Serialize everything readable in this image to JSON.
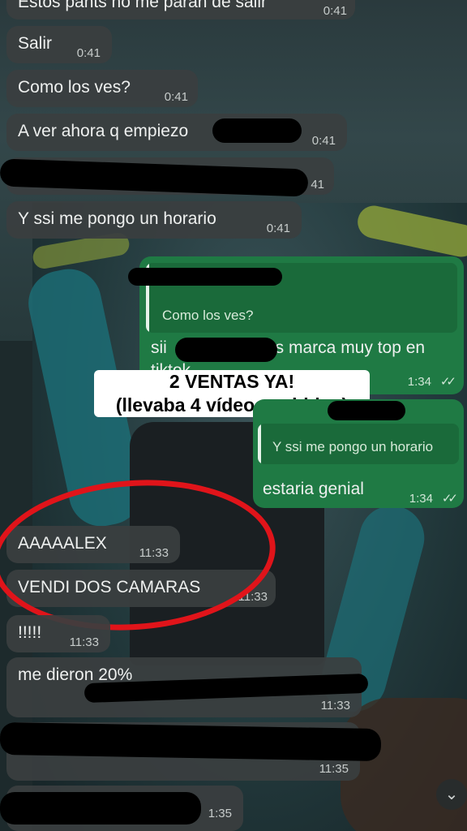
{
  "messages": [
    {
      "text": "Estos pants no me paran de salir",
      "time": "0:41"
    },
    {
      "text": "Salir",
      "time": "0:41"
    },
    {
      "text": "Como los ves?",
      "time": "0:41"
    },
    {
      "text": "A ver ahora q empiezo",
      "time": "0:41"
    },
    {
      "text": "",
      "time": "41"
    },
    {
      "text": "Y ssi me pongo un horario",
      "time": "0:41"
    },
    {
      "quote": "Como los ves?",
      "text": "sii",
      "text2": "es marca muy top en",
      "text3": "tiktok",
      "time": "1:34"
    },
    {
      "quote": "Y ssi me pongo un horario",
      "text": "estaria genial",
      "time": "1:34"
    },
    {
      "text": "AAAAALEX",
      "time": "11:33"
    },
    {
      "text": "VENDI DOS CAMARAS",
      "time": "11:33"
    },
    {
      "text": "!!!!!",
      "time": "11:33"
    },
    {
      "text": "me dieron 20%",
      "time": "11:33"
    },
    {
      "text": "",
      "time": "11:35"
    },
    {
      "text": "",
      "time": "1:35"
    }
  ],
  "caption": {
    "line1": "2 VENTAS YA!",
    "line2": "(llevaba 4 vídeos subidos)"
  },
  "read_ticks": "✓✓",
  "scroll_down_icon": "⌄",
  "colors": {
    "incoming": "#3a3e3f",
    "outgoing": "#1f7a44",
    "circle": "#e0141a"
  }
}
